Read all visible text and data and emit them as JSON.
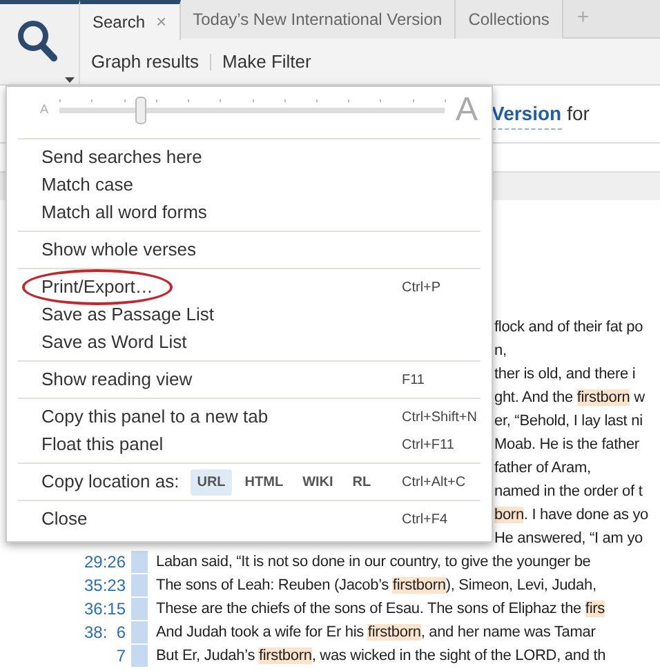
{
  "tabs": [
    {
      "label": "Search",
      "selected": true,
      "close": "×"
    },
    {
      "label": "Today’s New International Version",
      "selected": false
    },
    {
      "label": "Collections",
      "selected": false
    }
  ],
  "new_tab": "+",
  "toolbar": [
    "Graph results",
    "Make Filter"
  ],
  "query_line": {
    "link": "Version",
    "text": "for"
  },
  "menu": [
    {
      "kind": "slider",
      "small_label": "A",
      "large_label": "A",
      "level": 0.21
    },
    {
      "kind": "separator"
    },
    {
      "kind": "item",
      "label": "Send searches here",
      "circled": false
    },
    {
      "kind": "item",
      "label": "Match case",
      "circled": false
    },
    {
      "kind": "item",
      "label": "Match all word forms",
      "circled": false
    },
    {
      "kind": "separator"
    },
    {
      "kind": "item",
      "label": "Show whole verses",
      "circled": false
    },
    {
      "kind": "separator"
    },
    {
      "kind": "item",
      "label": "Print/Export…",
      "shortcut": "Ctrl+P",
      "circled": true
    },
    {
      "kind": "item",
      "label": "Save as Passage List",
      "circled": false
    },
    {
      "kind": "item",
      "label": "Save as Word List",
      "circled": false
    },
    {
      "kind": "separator"
    },
    {
      "kind": "item",
      "label": "Show reading view",
      "shortcut": "F11",
      "circled": false
    },
    {
      "kind": "separator"
    },
    {
      "kind": "item",
      "label": "Copy this panel to a new tab",
      "shortcut": "Ctrl+Shift+N",
      "circled": false
    },
    {
      "kind": "item",
      "label": "Float this panel",
      "shortcut": "Ctrl+F11",
      "circled": false
    },
    {
      "kind": "separator"
    },
    {
      "kind": "formats",
      "label": "Copy location as:",
      "shortcut": "Ctrl+Alt+C",
      "formats": [
        {
          "label": "URL",
          "selected": true
        },
        {
          "label": "HTML",
          "selected": false
        },
        {
          "label": "WIKI",
          "selected": false
        },
        {
          "label": "RL",
          "selected": false
        }
      ]
    },
    {
      "kind": "separator"
    },
    {
      "kind": "item",
      "label": "Close",
      "shortcut": "Ctrl+F4",
      "circled": false
    }
  ],
  "results": [
    {
      "kind": "partial",
      "segments": [
        {
          "text": "flock and of their fat po",
          "highlighted": false
        }
      ]
    },
    {
      "kind": "partial",
      "segments": [
        {
          "text": "n,",
          "highlighted": false
        }
      ]
    },
    {
      "kind": "partial",
      "segments": [
        {
          "text": "ther is old, and there i",
          "highlighted": false
        }
      ]
    },
    {
      "kind": "partial",
      "segments": [
        {
          "text": "ght. And the ",
          "highlighted": false
        },
        {
          "text": "firstborn",
          "highlighted": true
        },
        {
          "text": " w",
          "highlighted": false
        }
      ]
    },
    {
      "kind": "partial",
      "segments": [
        {
          "text": "er, “Behold, I lay last ni",
          "highlighted": false
        }
      ]
    },
    {
      "kind": "partial",
      "segments": [
        {
          "text": "Moab. He is the father",
          "highlighted": false
        }
      ]
    },
    {
      "kind": "partial",
      "segments": [
        {
          "text": "father of Aram,",
          "highlighted": false
        }
      ]
    },
    {
      "kind": "partial",
      "segments": [
        {
          "text": "named in the order of t",
          "highlighted": false
        }
      ]
    },
    {
      "kind": "partial",
      "segments": [
        {
          "text": "born",
          "highlighted": true
        },
        {
          "text": ". I have done as yo",
          "highlighted": false
        }
      ]
    },
    {
      "kind": "partial",
      "segments": [
        {
          "text": "He answered, “I am yo",
          "highlighted": false
        }
      ]
    },
    {
      "kind": "full",
      "ref": "29:26",
      "segments": [
        {
          "text": "Laban said, “It is not so done in our country, to give the younger be",
          "highlighted": false
        }
      ]
    },
    {
      "kind": "full",
      "ref": "35:23",
      "segments": [
        {
          "text": "The sons of Leah: Reuben (Jacob’s ",
          "highlighted": false
        },
        {
          "text": "firstborn",
          "highlighted": true
        },
        {
          "text": "), Simeon, Levi, Judah,",
          "highlighted": false
        }
      ]
    },
    {
      "kind": "full",
      "ref": "36:15",
      "segments": [
        {
          "text": "These are the chiefs of the sons of Esau. The sons of Eliphaz the ",
          "highlighted": false
        },
        {
          "text": "firs",
          "highlighted": true
        }
      ]
    },
    {
      "kind": "full",
      "ref": "38:  6",
      "segments": [
        {
          "text": "And Judah took a wife for Er his ",
          "highlighted": false
        },
        {
          "text": "firstborn",
          "highlighted": true
        },
        {
          "text": ", and her name was Tamar",
          "highlighted": false
        }
      ]
    },
    {
      "kind": "full",
      "ref": "7",
      "segments": [
        {
          "text": "But Er, Judah’s ",
          "highlighted": false
        },
        {
          "text": "firstborn",
          "highlighted": true
        },
        {
          "text": ", was wicked in the sight of the LORD, and th",
          "highlighted": false
        }
      ]
    }
  ]
}
